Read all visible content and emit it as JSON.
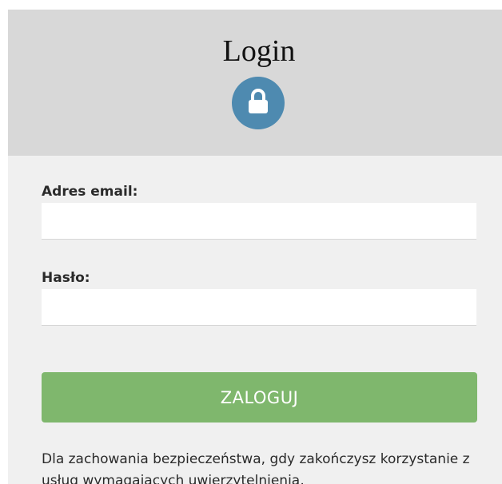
{
  "header": {
    "title": "Login",
    "icon": "lock-icon"
  },
  "form": {
    "email_label": "Adres email:",
    "email_value": "",
    "password_label": "Hasło:",
    "password_value": "",
    "submit_label": "ZALOGUJ"
  },
  "notice": {
    "text": "Dla zachowania bezpieczeństwa, gdy zakończysz korzystanie z usług wymagających uwierzytelnienia,"
  },
  "colors": {
    "header_bg": "#d8d8d8",
    "card_bg": "#f0f0f0",
    "accent_blue": "#4e8ab0",
    "button_green": "#7fb76d"
  }
}
